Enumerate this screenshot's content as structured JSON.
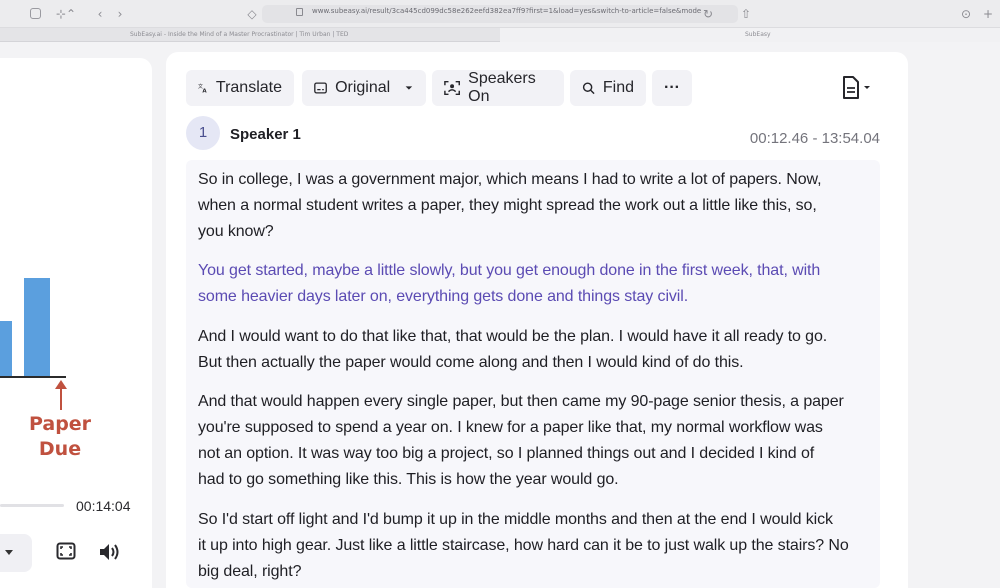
{
  "browser": {
    "url": "www.subeasy.ai/result/3ca445cd099dc58e262eefd382ea7ff9?first=1&load=yes&switch-to-article=false&mode",
    "tabs": [
      {
        "label": "SubEasy.ai - Inside the Mind of a Master Procrastinator | Tim Urban | TED"
      },
      {
        "label": "SubEasy"
      }
    ]
  },
  "video": {
    "annotation_line1": "Paper",
    "annotation_line2": "Due",
    "time": "00:14:04",
    "accent_color": "#5b9fde",
    "annotation_color": "#c0513f"
  },
  "toolbar": {
    "translate_label": "Translate",
    "original_label": "Original",
    "speakers_label": "Speakers On",
    "find_label": "Find",
    "more_label": "···"
  },
  "speaker": {
    "number": "1",
    "name": "Speaker 1",
    "time_range": "00:12.46 - 13:54.04"
  },
  "paragraphs": [
    {
      "line1": "So in college, I was a government major, which means I had to write a lot of papers. Now,",
      "line2": "when a normal student writes a paper, they might spread the work out a little like this, so,",
      "line3": "you know?"
    },
    {
      "line1": "You get started, maybe a little slowly, but you get enough done in the first week, that, with",
      "line2": "some heavier days later on, everything gets done and things stay civil."
    },
    {
      "line1": "And I would want to do that like that, that would be the plan. I would have it all ready to go.",
      "line2": "But then actually the paper would come along and then I would kind of do this."
    },
    {
      "line1": "And that would happen every single paper, but then came my 90-page senior thesis, a paper",
      "line2": "you're supposed to spend a year on. I knew for a paper like that, my normal workflow was",
      "line3": "not an option. It was way too big a project, so I planned things out and I decided I kind of",
      "line4": "had to go something like this. This is how the year would go."
    },
    {
      "line1": "So I'd start off light and I'd bump it up in the middle months and then at the end I would kick",
      "line2": "it up into high gear. Just like a little staircase, how hard can it be to just walk up the stairs? No",
      "line3": "big deal, right?"
    }
  ],
  "colors": {
    "active_paragraph": "#5b4bb3",
    "button_bg": "#f2f2f6"
  }
}
